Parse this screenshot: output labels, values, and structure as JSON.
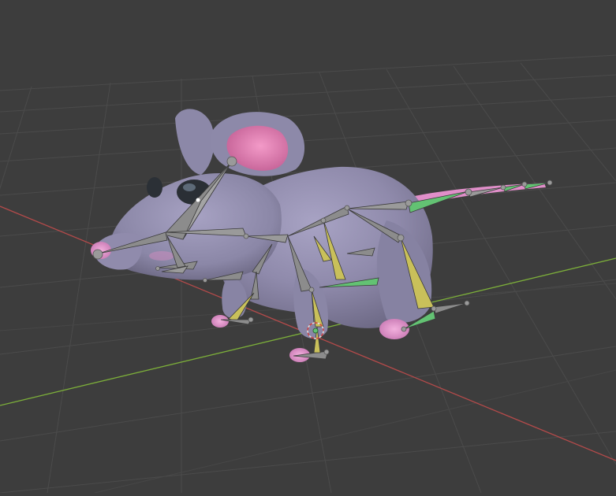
{
  "viewport": {
    "background": "#3d3d3d",
    "grid_color": "#4a4a4a",
    "x_axis_color": "#b34a4a",
    "y_axis_color": "#7cae3a"
  },
  "model": {
    "subject": "mouse",
    "body_color": "#8f8aab",
    "ear_inner_color": "#e07ab0",
    "paw_color": "#e79ad0"
  },
  "armature": {
    "bone_gray": "#8c8c8c",
    "bone_yellow": "#c9c05a",
    "bone_green": "#63c273"
  },
  "cursor_3d": {
    "icon": "3d-cursor-icon"
  }
}
